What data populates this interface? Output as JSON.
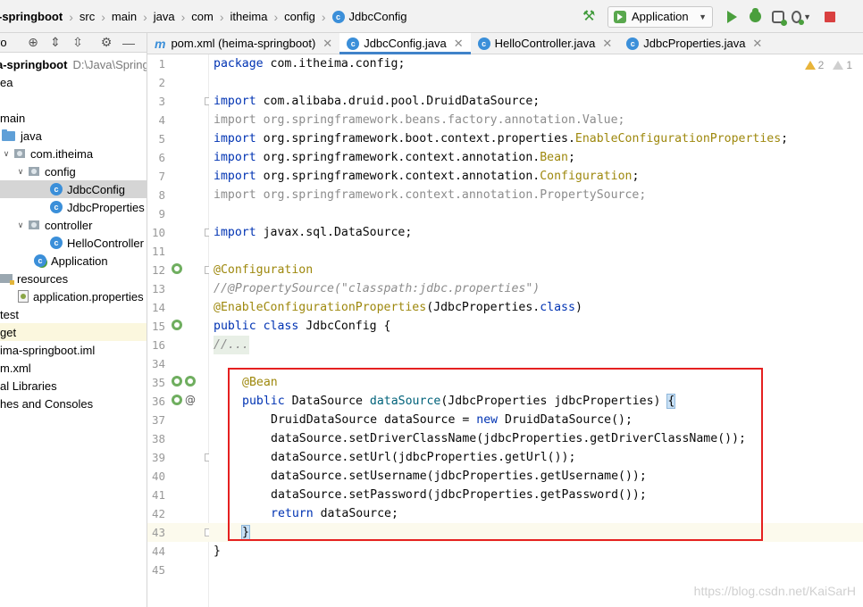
{
  "breadcrumb": {
    "project": "-springboot",
    "items": [
      "src",
      "main",
      "java",
      "com",
      "itheima",
      "config"
    ],
    "file": "JdbcConfig"
  },
  "toolbar": {
    "run_config": "Application"
  },
  "project_panel": {
    "title": "ro"
  },
  "tree": [
    {
      "label": "a-springboot",
      "extra": "D:\\Java\\Spring"
    },
    {
      "label": "ea"
    },
    {
      "label": "main"
    },
    {
      "label": "java"
    },
    {
      "label": "com.itheima"
    },
    {
      "label": "config"
    },
    {
      "label": "JdbcConfig"
    },
    {
      "label": "JdbcProperties"
    },
    {
      "label": "controller"
    },
    {
      "label": "HelloController"
    },
    {
      "label": "Application"
    },
    {
      "label": "resources"
    },
    {
      "label": "application.properties"
    },
    {
      "label": "test"
    },
    {
      "label": "get"
    },
    {
      "label": "ima-springboot.iml"
    },
    {
      "label": "m.xml"
    },
    {
      "label": "al Libraries"
    },
    {
      "label": "hes and Consoles"
    }
  ],
  "tabs": [
    {
      "label": "pom.xml (heima-springboot)",
      "icon": "m"
    },
    {
      "label": "JdbcConfig.java",
      "icon": "c"
    },
    {
      "label": "HelloController.java",
      "icon": "c"
    },
    {
      "label": "JdbcProperties.java",
      "icon": "c"
    }
  ],
  "inspections": {
    "warnings": "2",
    "weak_warnings": "1"
  },
  "code_lines": [
    {
      "n": "1"
    },
    {
      "n": "2"
    },
    {
      "n": "3"
    },
    {
      "n": "4"
    },
    {
      "n": "5"
    },
    {
      "n": "6"
    },
    {
      "n": "7"
    },
    {
      "n": "8"
    },
    {
      "n": "9"
    },
    {
      "n": "10"
    },
    {
      "n": "11"
    },
    {
      "n": "12"
    },
    {
      "n": "13"
    },
    {
      "n": "14"
    },
    {
      "n": "15"
    },
    {
      "n": "16"
    },
    {
      "n": "34"
    },
    {
      "n": "35"
    },
    {
      "n": "36"
    },
    {
      "n": "37"
    },
    {
      "n": "38"
    },
    {
      "n": "39"
    },
    {
      "n": "40"
    },
    {
      "n": "41"
    },
    {
      "n": "42"
    },
    {
      "n": "43"
    },
    {
      "n": "44"
    },
    {
      "n": "45"
    }
  ],
  "code": {
    "l1a": "package ",
    "l1b": "com.itheima.config;",
    "l3a": "import ",
    "l3b": "com.alibaba.druid.pool.DruidDataSource;",
    "l4": "import org.springframework.beans.factory.annotation.Value;",
    "l5a": "import ",
    "l5b": "org.springframework.boot.context.properties.",
    "l5c": "EnableConfigurationProperties",
    "l5d": ";",
    "l6a": "import ",
    "l6b": "org.springframework.context.annotation.",
    "l6c": "Bean",
    "l6d": ";",
    "l7a": "import ",
    "l7b": "org.springframework.context.annotation.",
    "l7c": "Configuration",
    "l7d": ";",
    "l8": "import org.springframework.context.annotation.PropertySource;",
    "l10a": "import ",
    "l10b": "javax.sql.DataSource;",
    "l12": "@Configuration",
    "l13": "//@PropertySource(\"classpath:jdbc.properties\")",
    "l14a": "@EnableConfigurationProperties",
    "l14b": "(JdbcProperties.",
    "l14c": "class",
    "l14d": ")",
    "l15a": "public class ",
    "l15b": "JdbcConfig {",
    "l16": "//...",
    "l35": "@Bean",
    "l36a": "public ",
    "l36b": "DataSource ",
    "l36c": "dataSource",
    "l36d": "(JdbcProperties jdbcProperties) ",
    "l36e": "{",
    "l37a": "DruidDataSource dataSource = ",
    "l37b": "new ",
    "l37c": "DruidDataSource();",
    "l38": "dataSource.setDriverClassName(jdbcProperties.getDriverClassName());",
    "l39": "dataSource.setUrl(jdbcProperties.getUrl());",
    "l40": "dataSource.setUsername(jdbcProperties.getUsername());",
    "l41": "dataSource.setPassword(jdbcProperties.getPassword());",
    "l42a": "return ",
    "l42b": "dataSource;",
    "l43": "}",
    "l44": "}"
  },
  "watermark": "https://blog.csdn.net/KaiSarH",
  "colors": {
    "keyword": "#0033b3",
    "annotation": "#9e880d",
    "comment": "#8c8c8c",
    "highlight_box": "#e52020",
    "active_tab_underline": "#4083c9"
  }
}
